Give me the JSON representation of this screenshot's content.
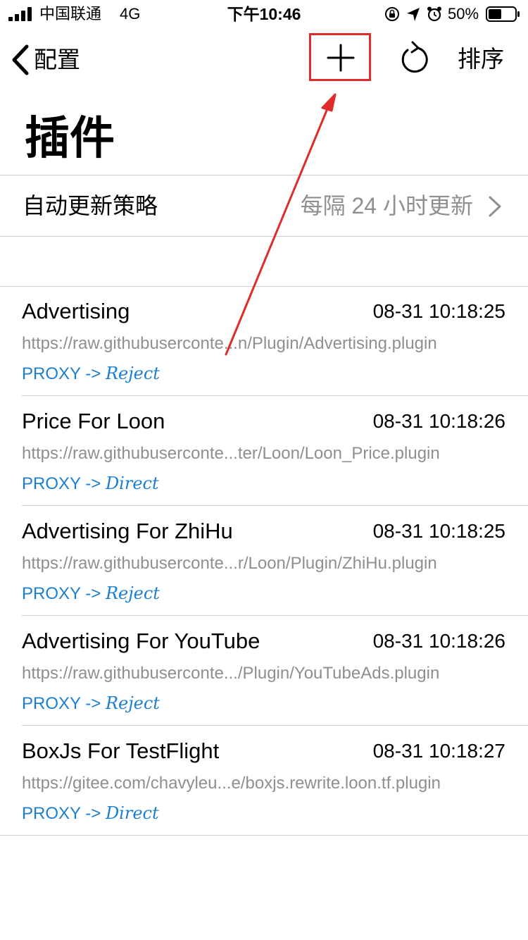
{
  "status_bar": {
    "carrier": "中国联通",
    "network": "4G",
    "time": "下午10:46",
    "battery_percent": "50%",
    "battery_level": 0.5,
    "icons": [
      "signal-icon",
      "orientation-lock-icon",
      "location-icon",
      "alarm-icon",
      "battery-icon"
    ]
  },
  "nav": {
    "back_label": "配置",
    "sort_label": "排序",
    "icons": [
      "chevron-left-icon",
      "plus-icon",
      "refresh-icon"
    ]
  },
  "page": {
    "title": "插件"
  },
  "auto_update": {
    "label": "自动更新策略",
    "value": "每隔 24 小时更新"
  },
  "plugins": [
    {
      "name": "Advertising",
      "time": "08-31 10:18:25",
      "url": "https://raw.githubuserconte...n/Plugin/Advertising.plugin",
      "policy_prefix": "PROXY ->",
      "policy_target": "Reject"
    },
    {
      "name": "Price For Loon",
      "time": "08-31 10:18:26",
      "url": "https://raw.githubuserconte...ter/Loon/Loon_Price.plugin",
      "policy_prefix": "PROXY ->",
      "policy_target": "Direct"
    },
    {
      "name": "Advertising For ZhiHu",
      "time": "08-31 10:18:25",
      "url": "https://raw.githubuserconte...r/Loon/Plugin/ZhiHu.plugin",
      "policy_prefix": "PROXY ->",
      "policy_target": "Reject"
    },
    {
      "name": "Advertising For YouTube",
      "time": "08-31 10:18:26",
      "url": "https://raw.githubuserconte.../Plugin/YouTubeAds.plugin",
      "policy_prefix": "PROXY ->",
      "policy_target": "Reject"
    },
    {
      "name": "BoxJs For TestFlight",
      "time": "08-31 10:18:27",
      "url": "https://gitee.com/chavyleu...e/boxjs.rewrite.loon.tf.plugin",
      "policy_prefix": "PROXY ->",
      "policy_target": "Direct"
    }
  ],
  "colors": {
    "accent_blue": "#1a7fd4",
    "secondary_gray": "#8e8e93",
    "annotation_red": "#e02b2b",
    "divider": "#cfcfd3"
  }
}
